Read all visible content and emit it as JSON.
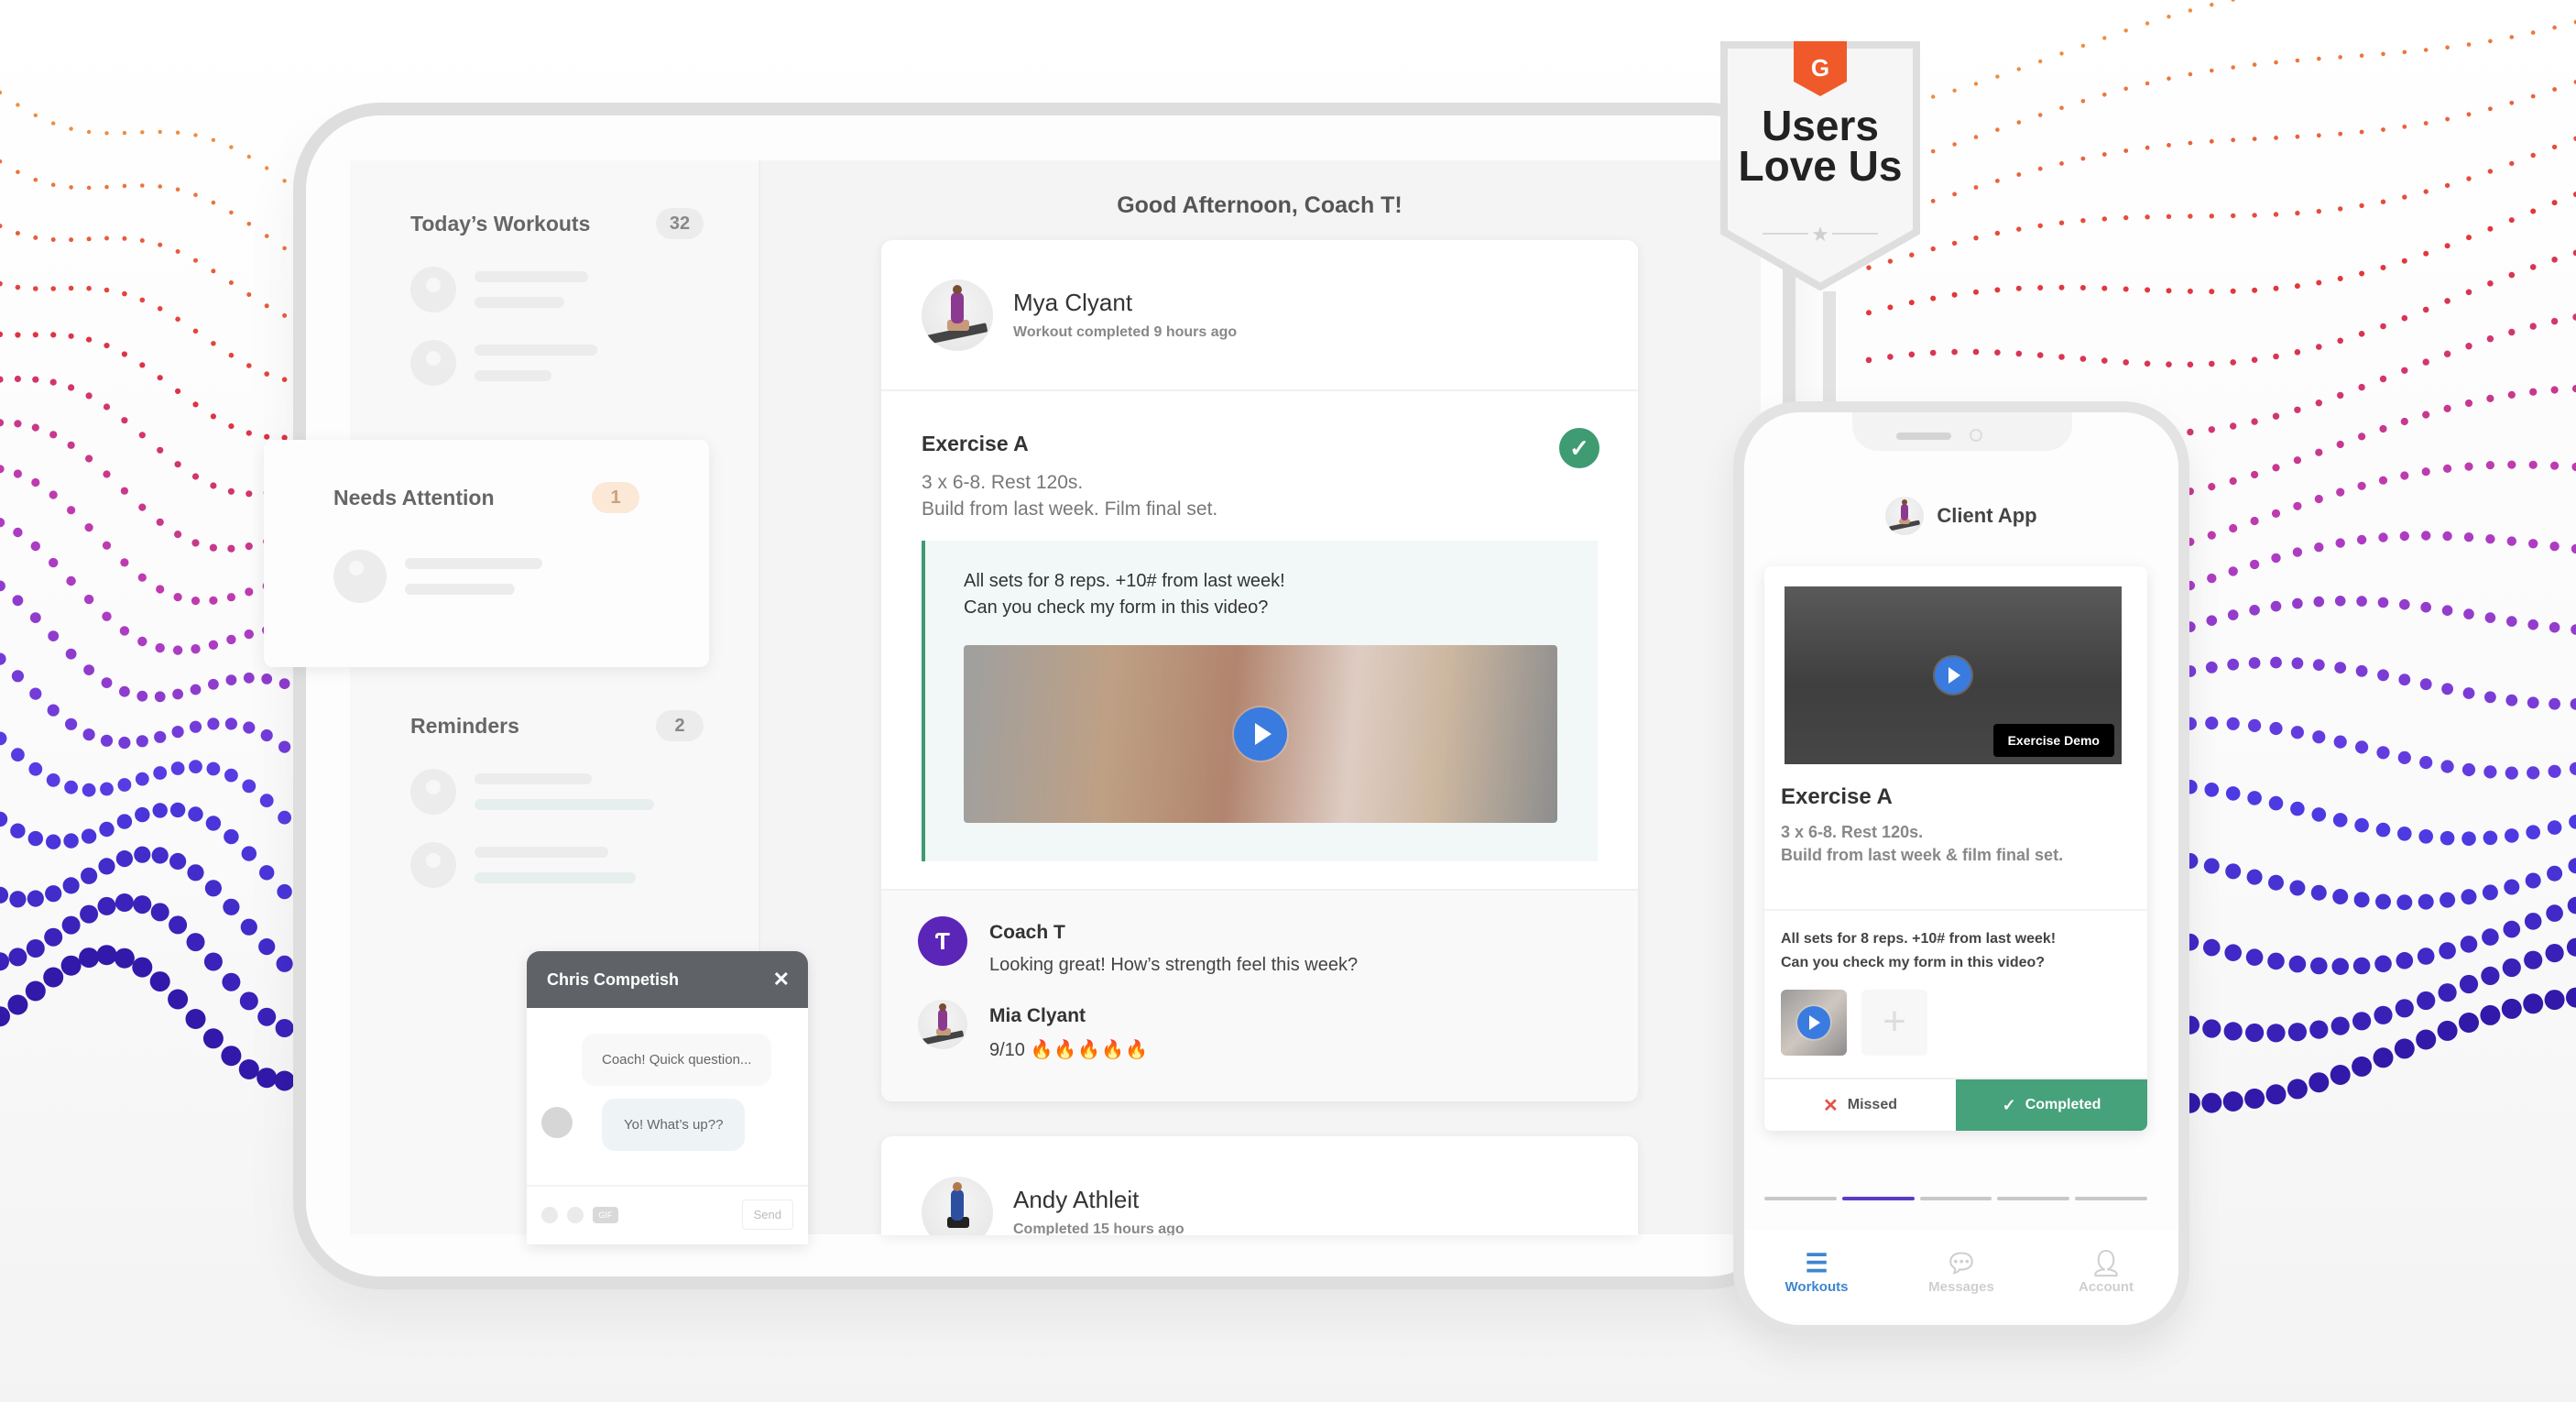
{
  "colors": {
    "accent_green": "#3e9b72",
    "completed_green": "#46a27b",
    "coach_purple": "#5b25b8",
    "play_blue": "#3a7be0",
    "pager_active": "#5b3cc4",
    "missed_red": "#e4534a",
    "tab_active": "#3d86cf",
    "g2_orange": "#f05a2a"
  },
  "sidebar": {
    "sections": [
      {
        "title": "Today’s Workouts",
        "count": "32"
      },
      {
        "title": "Needs Attention",
        "count": "1"
      },
      {
        "title": "Reminders",
        "count": "2"
      }
    ]
  },
  "main": {
    "greeting": "Good Afternoon, Coach T!",
    "workout_card": {
      "client_name": "Mya Clyant",
      "client_status": "Workout completed 9 hours ago",
      "exercise_title": "Exercise A",
      "exercise_line1": "3 x 6-8. Rest 120s.",
      "exercise_line2": "Build from last week. Film final set.",
      "status_icon": "check-circle-icon",
      "note_line1": "All sets for 8 reps. +10# from last week!",
      "note_line2": "Can you check my form in this video?",
      "comments": [
        {
          "author": "Coach T",
          "avatar_letter": "Ƭ",
          "text": "Looking great! How’s strength feel this week?"
        },
        {
          "author": "Mia Clyant",
          "rating": "9/10",
          "flames": "🔥🔥🔥🔥🔥"
        }
      ]
    },
    "second_card": {
      "client_name": "Andy Athleit",
      "client_status": "Completed 15 hours ago"
    }
  },
  "chat": {
    "title": "Chris Competish",
    "close": "✕",
    "messages": [
      {
        "direction": "in",
        "text": "Coach! Quick question..."
      },
      {
        "direction": "out",
        "text": "Yo! What’s up??"
      }
    ],
    "gif_label": "GIF",
    "send_label": "Send"
  },
  "badge": {
    "brand": "G2",
    "line1": "Users",
    "line2": "Love Us"
  },
  "phone": {
    "app_title": "Client App",
    "video_label": "Exercise Demo",
    "exercise_title": "Exercise A",
    "exercise_line1": "3 x 6-8. Rest 120s.",
    "exercise_line2": "Build from last week & film final set.",
    "note_line1": "All sets for 8 reps. +10# from last week!",
    "note_line2": "Can you check my form in this video?",
    "add_label": "+",
    "missed_label": "Missed",
    "completed_label": "Completed",
    "pager": {
      "total": 5,
      "active_index": 1
    },
    "tabs": [
      {
        "label": "Workouts",
        "icon": "list-icon",
        "active": true
      },
      {
        "label": "Messages",
        "icon": "chat-bubble-icon",
        "active": false
      },
      {
        "label": "Account",
        "icon": "user-icon",
        "active": false
      }
    ]
  }
}
